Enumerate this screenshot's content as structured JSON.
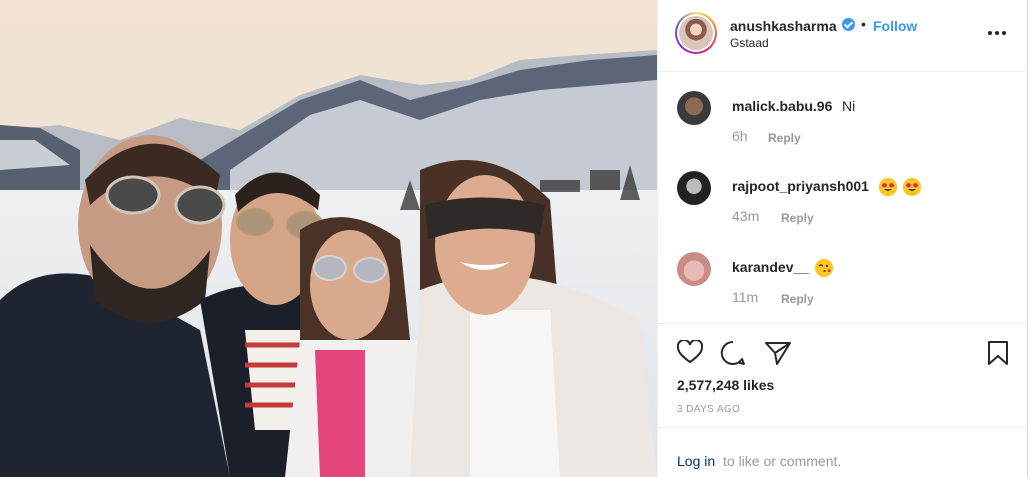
{
  "post": {
    "photo_icon": "group-selfie-photo",
    "header": {
      "username": "anushkasharma",
      "separator": "•",
      "follow_label": "Follow",
      "location": "Gstaad",
      "more_icon": "more-options-icon"
    },
    "comments": [
      {
        "username": "malick.babu.96",
        "text": "Ni",
        "time": "6h",
        "reply_label": "Reply"
      },
      {
        "username": "rajpoot_priyansh001",
        "text": "",
        "emojis": [
          "heart-eyes-emoji",
          "heart-eyes-emoji"
        ],
        "time": "43m",
        "reply_label": "Reply"
      },
      {
        "username": "karandev__",
        "text": "",
        "emojis": [
          "kissing-wink-emoji"
        ],
        "time": "11m",
        "reply_label": "Reply"
      }
    ],
    "likes": "2,577,248 likes",
    "timestamp": "3 DAYS AGO",
    "login": {
      "link": "Log in",
      "rest": "to like or comment."
    },
    "colors": {
      "follow": "#3897f0",
      "login_link": "#003569",
      "muted": "#999999",
      "text": "#262626"
    }
  }
}
